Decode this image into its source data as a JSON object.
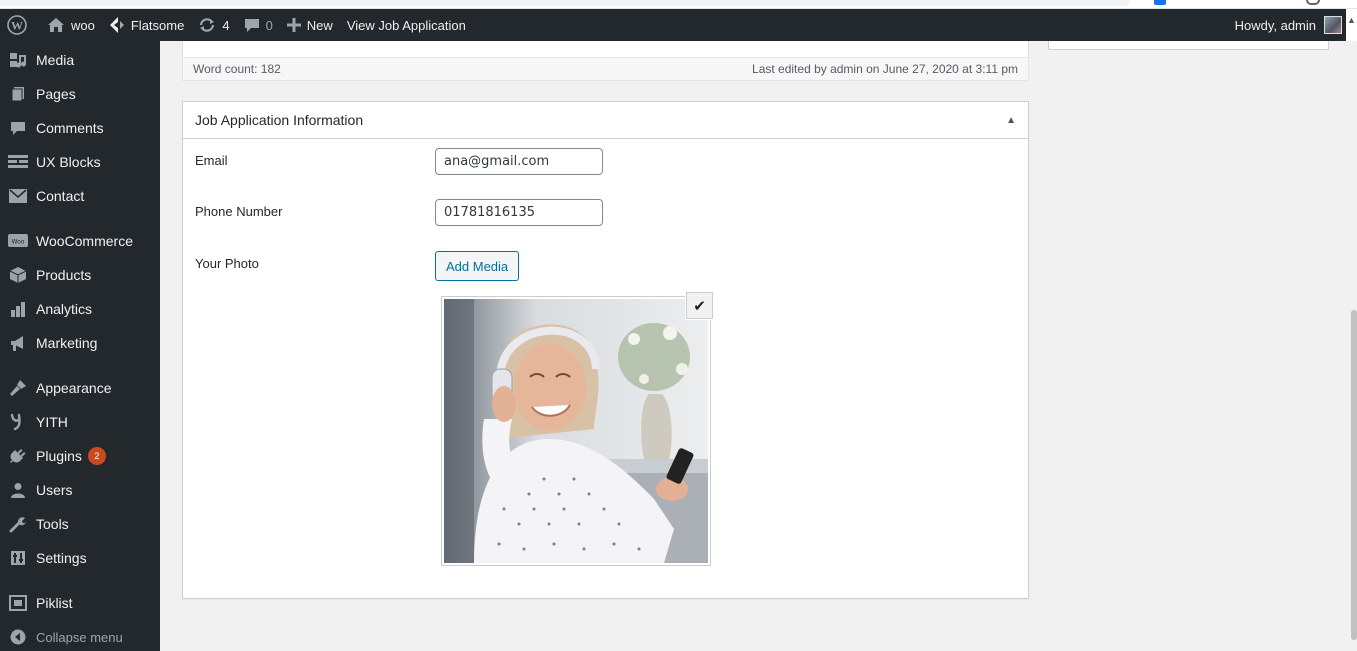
{
  "adminbar": {
    "site_name": "woo",
    "theme_name": "Flatsome",
    "updates_count": "4",
    "comments_count": "0",
    "new_label": "New",
    "view_label": "View Job Application",
    "howdy": "Howdy, admin"
  },
  "sidebar": {
    "items": [
      {
        "label": "Media",
        "icon": "media-icon"
      },
      {
        "label": "Pages",
        "icon": "pages-icon"
      },
      {
        "label": "Comments",
        "icon": "comments-icon"
      },
      {
        "label": "UX Blocks",
        "icon": "ux-blocks-icon"
      },
      {
        "label": "Contact",
        "icon": "contact-icon"
      },
      {
        "label": "WooCommerce",
        "icon": "woocommerce-icon"
      },
      {
        "label": "Products",
        "icon": "products-icon"
      },
      {
        "label": "Analytics",
        "icon": "analytics-icon"
      },
      {
        "label": "Marketing",
        "icon": "marketing-icon"
      },
      {
        "label": "Appearance",
        "icon": "appearance-icon"
      },
      {
        "label": "YITH",
        "icon": "yith-icon"
      },
      {
        "label": "Plugins",
        "icon": "plugins-icon",
        "badge": "2"
      },
      {
        "label": "Users",
        "icon": "users-icon"
      },
      {
        "label": "Tools",
        "icon": "tools-icon"
      },
      {
        "label": "Settings",
        "icon": "settings-icon"
      },
      {
        "label": "Piklist",
        "icon": "piklist-icon"
      }
    ],
    "collapse_label": "Collapse menu"
  },
  "editor": {
    "word_count": "Word count: 182",
    "last_edited": "Last edited by admin on June 27, 2020 at 3:11 pm"
  },
  "metabox": {
    "title": "Job Application Information",
    "fields": {
      "email_label": "Email",
      "email_value": "ana@gmail.com",
      "phone_label": "Phone Number",
      "phone_value": "01781816135",
      "photo_label": "Your Photo",
      "add_media_label": "Add Media"
    }
  },
  "colors": {
    "adminbar_bg": "#23282d",
    "accent": "#0071a1",
    "badge": "#ca4a1f"
  }
}
